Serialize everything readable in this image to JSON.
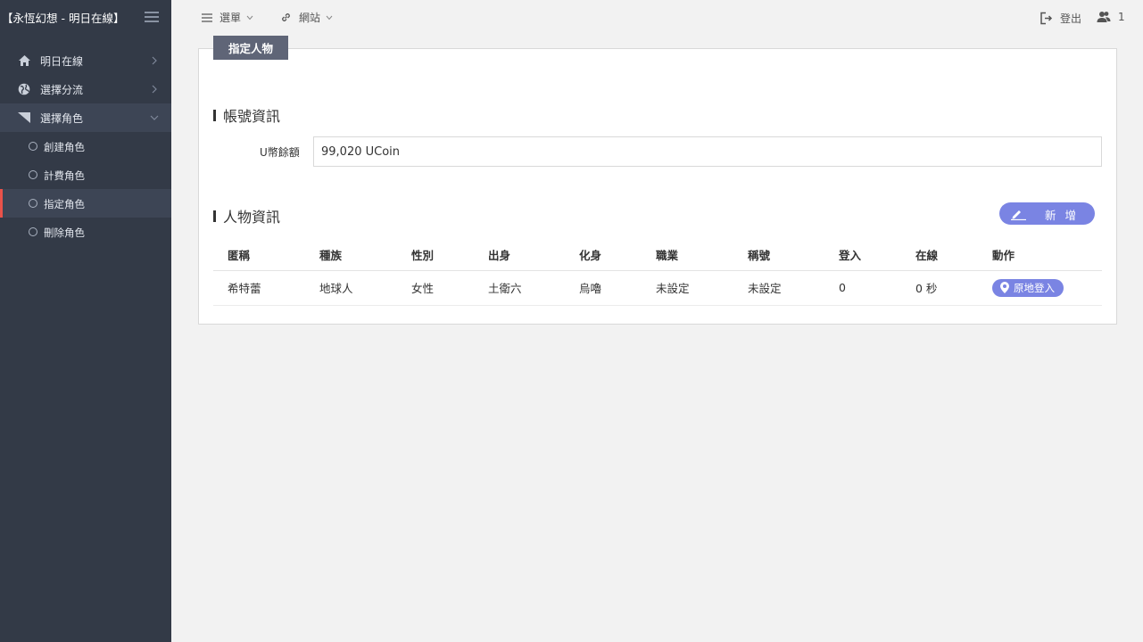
{
  "sidebar": {
    "brand": "【永恆幻想 - 明日在線】",
    "items": [
      {
        "label": "明日在線",
        "icon": "home-icon"
      },
      {
        "label": "選擇分流",
        "icon": "globe-icon"
      },
      {
        "label": "選擇角色",
        "icon": "triangle-icon"
      }
    ],
    "subitems": [
      {
        "label": "創建角色"
      },
      {
        "label": "計費角色"
      },
      {
        "label": "指定角色"
      },
      {
        "label": "刪除角色"
      }
    ]
  },
  "topbar": {
    "menu_label": "選單",
    "site_label": "網站",
    "logout_label": "登出",
    "users_count": "1"
  },
  "panel": {
    "tab_label": "指定人物",
    "account_section": "帳號資訊",
    "ucoin_label": "U幣餘額",
    "ucoin_value": "99,020 UCoin",
    "character_section": "人物資訊",
    "add_button": "新增",
    "table": {
      "headers": [
        "匿稱",
        "種族",
        "性別",
        "出身",
        "化身",
        "職業",
        "稱號",
        "登入",
        "在線",
        "動作"
      ],
      "rows": [
        {
          "name": "希特蕾",
          "race": "地球人",
          "gender": "女性",
          "origin": "土衛六",
          "avatar": "烏嚕",
          "job": "未設定",
          "title": "未設定",
          "logins": "0",
          "online": "0 秒",
          "action": "原地登入"
        }
      ]
    }
  },
  "colors": {
    "sidebar_bg": "#333a47",
    "accent": "#7a84e3",
    "active_marker": "#e9524a",
    "tab_bg": "#5f6577"
  }
}
